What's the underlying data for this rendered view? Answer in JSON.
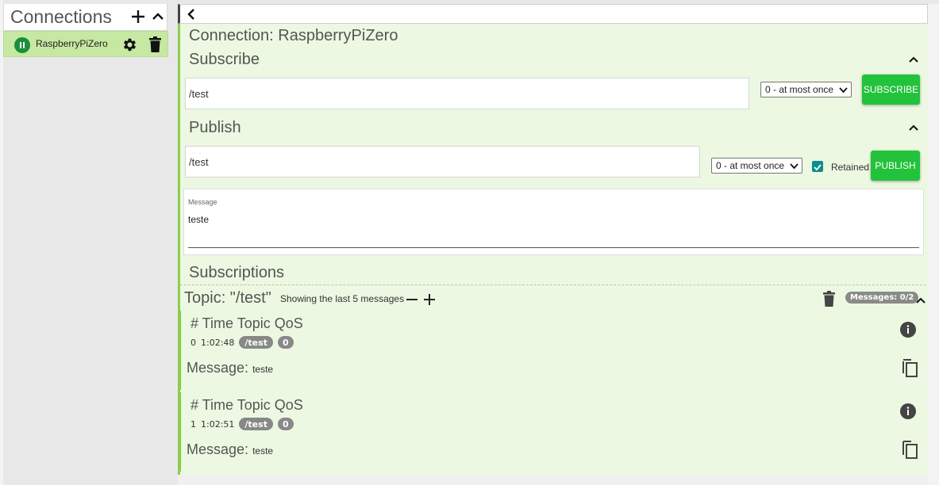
{
  "sidebar": {
    "title": "Connections",
    "connection": {
      "name": "RaspberryPiZero",
      "status": "connected"
    }
  },
  "main": {
    "connection_title": "Connection: RaspberryPiZero",
    "subscribe": {
      "title": "Subscribe",
      "topic_value": "/test",
      "qos_selected": "0 - at most once",
      "button_label": "SUBSCRIBE"
    },
    "publish": {
      "title": "Publish",
      "topic_value": "/test",
      "qos_selected": "0 - at most once",
      "retained_label": "Retained",
      "retained_checked": true,
      "button_label": "PUBLISH",
      "message_caption": "Message",
      "message_value": "teste"
    },
    "subscriptions": {
      "title": "Subscriptions",
      "topic_title": "Topic: \"/test\"",
      "showing_text": "Showing the last 5 messages",
      "count_badge": "Messages: 0/2",
      "messages": [
        {
          "header": "# Time Topic QoS",
          "index": "0",
          "time": "1:02:48",
          "topic": "/test",
          "qos": "0",
          "message_label": "Message:",
          "message_value": "teste"
        },
        {
          "header": "# Time Topic QoS",
          "index": "1",
          "time": "1:02:51",
          "topic": "/test",
          "qos": "0",
          "message_label": "Message:",
          "message_value": "teste"
        }
      ]
    }
  },
  "colors": {
    "accent_green": "#23c23b",
    "panel_bg": "#ecf8e1",
    "connection_item_bg": "#c7e8a2",
    "checkbox": "#0d8f8a"
  }
}
